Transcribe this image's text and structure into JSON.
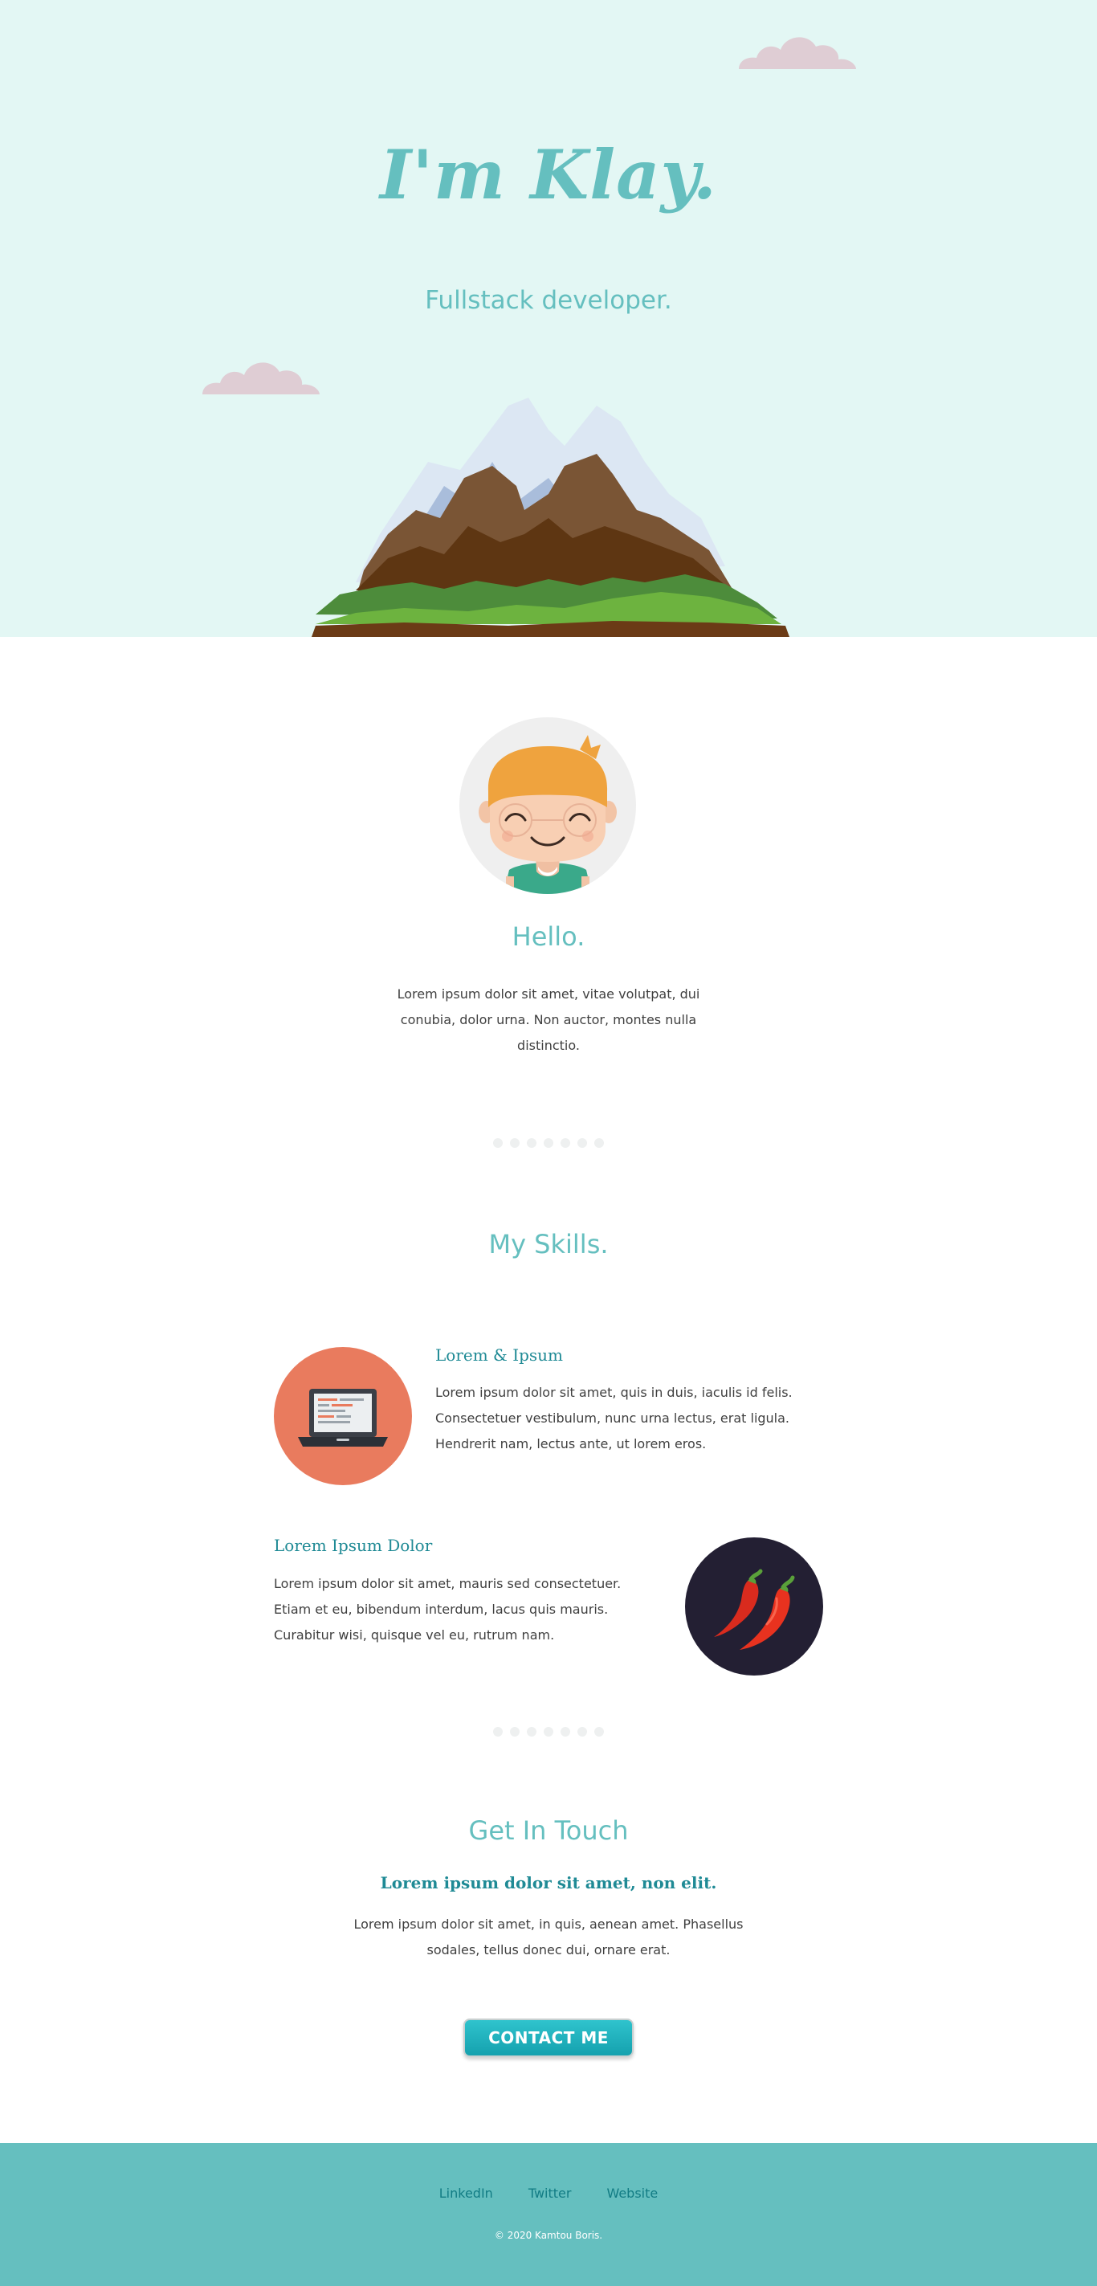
{
  "hero": {
    "title": "I'm Klay.",
    "subtitle": "Fullstack developer."
  },
  "about": {
    "title": "Hello.",
    "text": "Lorem ipsum dolor sit amet, vitae volutpat, dui conubia, dolor urna. Non auctor, montes nulla distinctio."
  },
  "skills": {
    "title": "My Skills.",
    "items": [
      {
        "heading": "Lorem & Ipsum",
        "text": "Lorem ipsum dolor sit amet, quis in duis, iaculis id felis. Consectetuer vestibulum, nunc urna lectus, erat ligula. Hendrerit nam, lectus ante, ut lorem eros.",
        "icon": "laptop-icon"
      },
      {
        "heading": "Lorem Ipsum Dolor",
        "text": "Lorem ipsum dolor sit amet, mauris sed consectetuer. Etiam et eu, bibendum interdum, lacus quis mauris. Curabitur wisi, quisque vel eu, rutrum nam.",
        "icon": "chili-peppers-icon"
      }
    ]
  },
  "contact": {
    "title": "Get In Touch",
    "subtitle": "Lorem ipsum dolor sit amet, non elit.",
    "text": "Lorem ipsum dolor sit amet, in quis, aenean amet. Phasellus sodales, tellus donec dui, ornare erat.",
    "button_label": "CONTACT ME"
  },
  "footer": {
    "links": [
      "LinkedIn",
      "Twitter",
      "Website"
    ],
    "copyright": "© 2020 Kamtou Boris."
  },
  "colors": {
    "hero_bg": "#e3f7f4",
    "accent": "#65bfbf",
    "heading_dark": "#1f8a95",
    "skill_1_circle": "#e97b5e",
    "skill_2_circle": "#231f33",
    "footer_bg": "#65bfbf"
  }
}
